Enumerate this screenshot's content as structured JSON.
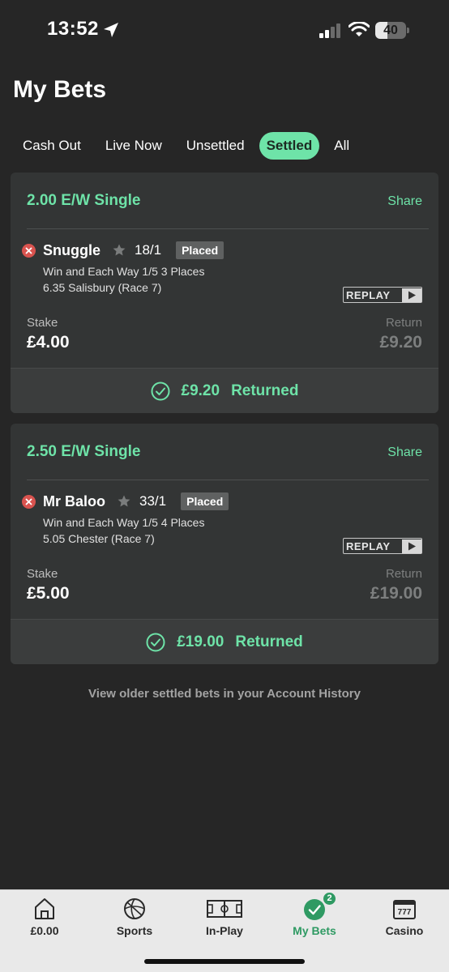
{
  "status_bar": {
    "time": "13:52",
    "battery": "40",
    "battery_level": 0.4
  },
  "header": {
    "title": "My Bets"
  },
  "tabs": [
    {
      "label": "Cash Out",
      "active": false
    },
    {
      "label": "Live Now",
      "active": false
    },
    {
      "label": "Unsettled",
      "active": false
    },
    {
      "label": "Settled",
      "active": true
    },
    {
      "label": "All",
      "active": false
    }
  ],
  "bets": [
    {
      "bet_type": "2.00 E/W Single",
      "share_label": "Share",
      "runner": "Snuggle",
      "odds": "18/1",
      "status_badge": "Placed",
      "market": "Win and Each Way 1/5 3 Places",
      "event": "6.35 Salisbury (Race 7)",
      "replay_label": "REPLAY",
      "stake_label": "Stake",
      "stake": "£4.00",
      "return_label": "Return",
      "return": "£9.20",
      "returned_amount": "£9.20",
      "returned_label": "Returned"
    },
    {
      "bet_type": "2.50 E/W Single",
      "share_label": "Share",
      "runner": "Mr Baloo",
      "odds": "33/1",
      "status_badge": "Placed",
      "market": "Win and Each Way 1/5 4 Places",
      "event": "5.05 Chester (Race 7)",
      "replay_label": "REPLAY",
      "stake_label": "Stake",
      "stake": "£5.00",
      "return_label": "Return",
      "return": "£19.00",
      "returned_amount": "£19.00",
      "returned_label": "Returned"
    }
  ],
  "history_link": "View older settled bets in your Account History",
  "bottom_nav": [
    {
      "label": "£0.00",
      "icon": "home-icon",
      "active": false
    },
    {
      "label": "Sports",
      "icon": "football-icon",
      "active": false
    },
    {
      "label": "In-Play",
      "icon": "pitch-icon",
      "active": false
    },
    {
      "label": "My Bets",
      "icon": "check-circle-icon",
      "active": true,
      "badge": "2"
    },
    {
      "label": "Casino",
      "icon": "slot-machine-icon",
      "active": false
    }
  ],
  "colors": {
    "accent": "#6ee3a8",
    "background": "#262626",
    "card": "#333535",
    "lost": "#d9534f",
    "nav_active": "#2f9a63"
  }
}
